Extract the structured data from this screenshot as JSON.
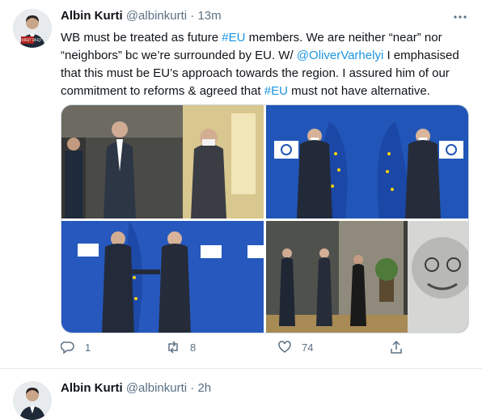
{
  "tweets": [
    {
      "author_name": "Albin Kurti",
      "handle": "@albinkurti",
      "separator": "·",
      "time": "13m",
      "avatar_badge_text": "KREJT DREJT",
      "text_segments": [
        {
          "text": "WB must be treated as future ",
          "type": "plain"
        },
        {
          "text": "#EU",
          "type": "hashtag"
        },
        {
          "text": " members. We are neither “near” nor “neighbors” bc we’re surrounded by EU. W/ ",
          "type": "plain"
        },
        {
          "text": "@OliverVarhelyi",
          "type": "mention"
        },
        {
          "text": " I emphasised that this must be EU’s approach towards the region. I assured him of our commitment to reforms & agreed that ",
          "type": "plain"
        },
        {
          "text": "#EU",
          "type": "hashtag"
        },
        {
          "text": " must not have alternative.",
          "type": "plain"
        }
      ],
      "media": [
        {
          "description": "Two men in suits talking in an office hallway"
        },
        {
          "description": "Two men standing in front of blue EU flags"
        },
        {
          "description": "Elbow greeting in front of EU flags backdrop"
        },
        {
          "description": "Walking through a lobby with large portrait wall"
        }
      ],
      "actions": {
        "reply_count": "1",
        "retweet_count": "8",
        "like_count": "74"
      }
    },
    {
      "author_name": "Albin Kurti",
      "handle": "@albinkurti",
      "separator": "·",
      "time": "2h"
    }
  ],
  "colors": {
    "link": "#1b95e0",
    "secondary_text": "#5b7083",
    "eu_blue": "#2156b8",
    "eu_yellow": "#f6d20a"
  }
}
